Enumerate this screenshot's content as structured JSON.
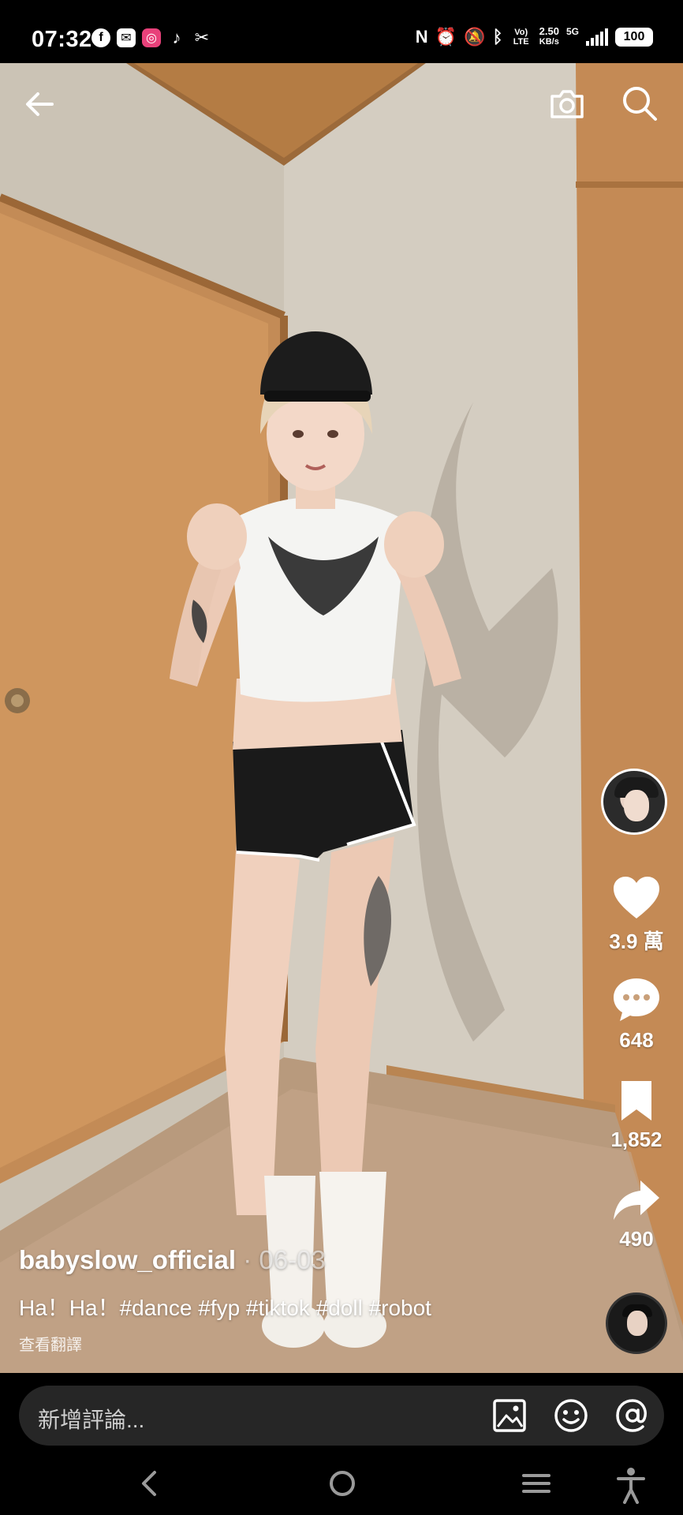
{
  "status_bar": {
    "time": "07:32",
    "app_icons": [
      "facebook-icon",
      "messenger-icon",
      "instagram-icon",
      "tiktok-icon",
      "tool-icon"
    ],
    "network_top": "Vo) LTE",
    "speed_value": "2.50",
    "speed_unit": "KB/s",
    "network_gen": "5G",
    "battery": "100"
  },
  "top_bar": {
    "back_icon": "arrow-left-icon",
    "camera_icon": "camera-icon",
    "search_icon": "search-icon"
  },
  "actions": {
    "like_count": "3.9 萬",
    "comment_count": "648",
    "bookmark_count": "1,852",
    "share_count": "490"
  },
  "caption": {
    "username": "babyslow_official",
    "date": " · 06-03",
    "text": "Ha！Ha！#dance #fyp #tiktok #doll #robot",
    "translate": "查看翻譯"
  },
  "comment_bar": {
    "placeholder": "新增評論..."
  },
  "colors": {
    "background": "#000000",
    "comment_pill": "#262626",
    "text": "#ffffff"
  }
}
